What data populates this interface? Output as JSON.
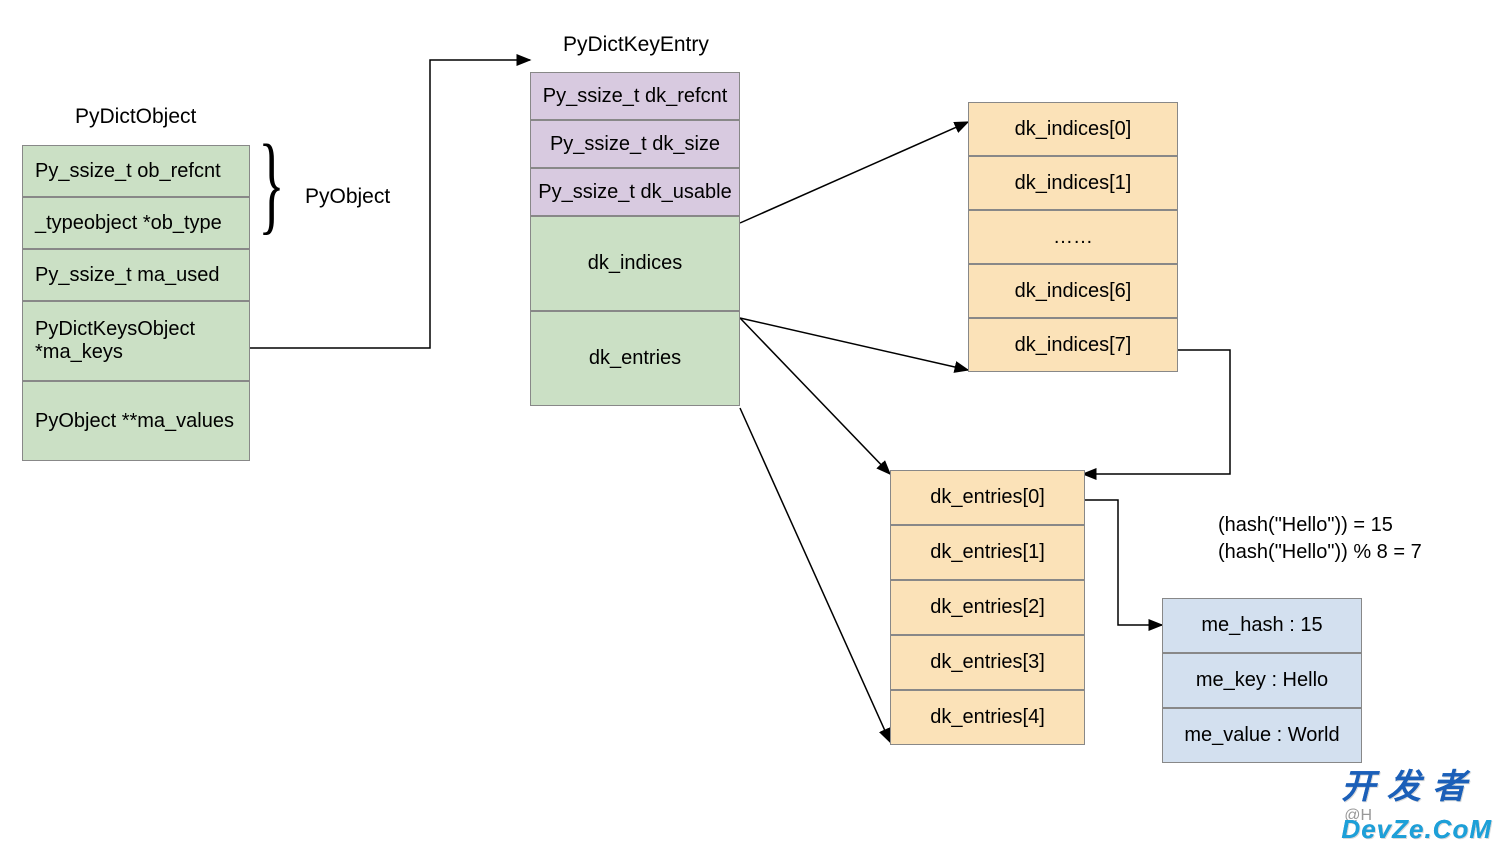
{
  "titles": {
    "pydictobject": "PyDictObject",
    "pydictkeyentry": "PyDictKeyEntry",
    "pyobject": "PyObject"
  },
  "dictobject": {
    "field1": "Py_ssize_t ob_refcnt",
    "field2": "_typeobject *ob_type",
    "field3": "Py_ssize_t ma_used",
    "field4a": "PyDictKeysObject",
    "field4b": "*ma_keys",
    "field5": "PyObject **ma_values"
  },
  "keyentry": {
    "f1": "Py_ssize_t dk_refcnt",
    "f2": "Py_ssize_t dk_size",
    "f3": "Py_ssize_t dk_usable",
    "f4": "dk_indices",
    "f5": "dk_entries"
  },
  "indices": {
    "i0": "dk_indices[0]",
    "i1": "dk_indices[1]",
    "idots": "……",
    "i6": "dk_indices[6]",
    "i7": "dk_indices[7]"
  },
  "entries": {
    "e0": "dk_entries[0]",
    "e1": "dk_entries[1]",
    "e2": "dk_entries[2]",
    "e3": "dk_entries[3]",
    "e4": "dk_entries[4]"
  },
  "hash": {
    "line1": "(hash(\"Hello\")) = 15",
    "line2": "(hash(\"Hello\")) % 8 = 7"
  },
  "value_struct": {
    "f1": "me_hash : 15",
    "f2": "me_key : Hello",
    "f3": "me_value : World"
  },
  "watermark1": "@H",
  "watermark2a": "开 发 者",
  "watermark2b": "DevZe.CoM"
}
